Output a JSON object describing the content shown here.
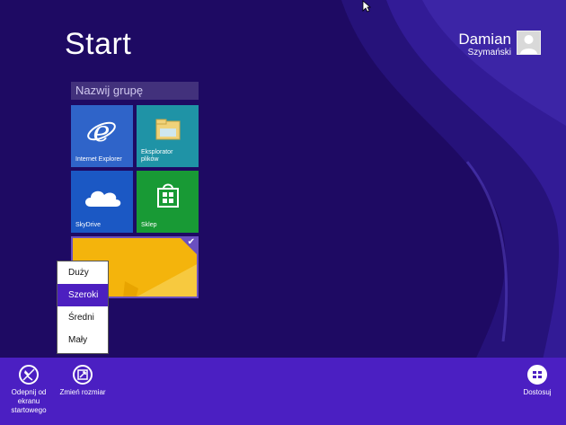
{
  "screen": {
    "title": "Start"
  },
  "user": {
    "first_name": "Damian",
    "last_name": "Szymański"
  },
  "group": {
    "name_placeholder": "Nazwij grupę"
  },
  "tiles": [
    {
      "label": "Internet Explorer",
      "icon": "internet-explorer-icon",
      "color": "#2f64c9"
    },
    {
      "label": "Eksplorator\nplików",
      "icon": "file-explorer-icon",
      "color": "#1f93a6"
    },
    {
      "label": "SkyDrive",
      "icon": "skydrive-cloud-icon",
      "color": "#1b58c4"
    },
    {
      "label": "Sklep",
      "icon": "store-bag-icon",
      "color": "#189a35"
    },
    {
      "label": "",
      "icon": "desktop-wallpaper",
      "color": "#f4b40c",
      "selected": true
    }
  ],
  "resize_menu": {
    "items": [
      "Duży",
      "Szeroki",
      "Średni",
      "Mały"
    ],
    "selected": "Szeroki"
  },
  "appbar": {
    "unpin_label": "Odepnij od ekranu startowego",
    "resize_label": "Zmień rozmiar",
    "customize_label": "Dostosuj"
  },
  "colors": {
    "background": "#1e0a63",
    "accent": "#4b1fc2",
    "selection": "#4c1fc0"
  }
}
